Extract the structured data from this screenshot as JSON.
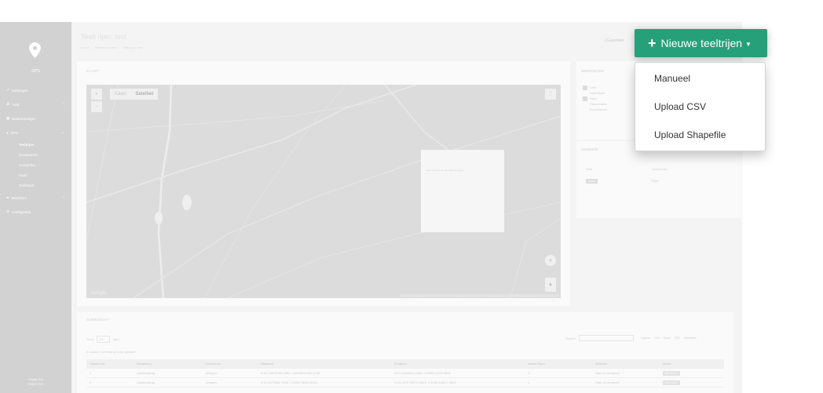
{
  "sidebar": {
    "logo_text": "GPS",
    "items": [
      {
        "label": "Verbergen",
        "chevron": ""
      },
      {
        "label": "Veld",
        "chevron": "‹"
      },
      {
        "label": "Waarnemingen",
        "chevron": ""
      },
      {
        "label": "GPS",
        "chevron": "⌄"
      }
    ],
    "gps_sub": [
      "Teeltrijen",
      "Bouwkanten",
      "Grasperks",
      "Kaart",
      "Teeltkaart"
    ],
    "more_items": [
      {
        "label": "Machines",
        "chevron": "‹"
      },
      {
        "label": "Configuratie",
        "chevron": ""
      }
    ],
    "version": [
      "Versie: 8.0",
      "©2021 IVO"
    ]
  },
  "header": {
    "title": "Teelt rijen: test",
    "breadcrumb": [
      "Home",
      "/",
      "Teelten bouwen",
      "/",
      "Teelt rijen: test"
    ],
    "export_label": "Exporteer"
  },
  "map_panel": {
    "title": "KAART",
    "zoom_in": "+",
    "zoom_out": "−",
    "map_type": [
      "Kaart",
      "Satelliet"
    ],
    "popup_text": "Geen content om hier weer te geven",
    "google": "Google",
    "attribution": "Sneltoetsen | Kaartgegevens ©2021 Imagery ©2021 Aerodata, Landsat, Maxar Technologies | 200 m | Gebruiksvoorwaarden | Een kaartfout rapporteren"
  },
  "layers_panel": {
    "title": "WEERGEVEN",
    "options": [
      {
        "label": "Veld",
        "checked": true
      },
      {
        "label": "Naamlabel",
        "checked": false
      },
      {
        "label": "Rijen",
        "checked": true
      },
      {
        "label": "Rijnummers",
        "checked": false
      },
      {
        "label": "Bouwkanten",
        "checked": false
      }
    ]
  },
  "legend_panel": {
    "title": "LEGENDE",
    "rows": [
      {
        "left": "Veld",
        "right": "Veldranden"
      },
      {
        "left": "Actief",
        "right": "Rijen"
      }
    ]
  },
  "overview": {
    "title": "OVERZICHT",
    "show_label": "Toon",
    "show_value": "10",
    "rows_label": "rijen",
    "search_label": "Zoeken",
    "export_buttons": [
      "Kopieer",
      "CSV",
      "Excel",
      "PDF",
      "Afdrukken"
    ],
    "info": "Er worden 1 tot 5 van de 5 rijen getoond",
    "columns": [
      "Rijnummer",
      "Bewerking",
      "Werkzaam",
      "Startpunt",
      "Eindpunt",
      "Aantal Rijen",
      "Methode",
      "Acties"
    ],
    "rows": [
      [
        "1",
        "Zaaibedijaag",
        "Afragen",
        "N 51.02629785 6390, 4.5268810436 6736",
        "N 51.0263843 3986, 4.52684 2295 5865",
        "2",
        "Start en eindpunt",
        "Bewerken"
      ],
      [
        "2",
        "Zaaibedijaag",
        "Afragen",
        "N 51.0279662 3928, 4.5268 78964 6024",
        "N 51.0275 93279 6849, 4.5268 4683 4 5822",
        "1",
        "Start en eindpunt",
        "Bewerken"
      ]
    ]
  },
  "new_rows": {
    "button_label": "Nieuwe teeltrijen",
    "accent": "#26a078",
    "menu": [
      "Manueel",
      "Upload CSV",
      "Upload Shapefile"
    ]
  }
}
